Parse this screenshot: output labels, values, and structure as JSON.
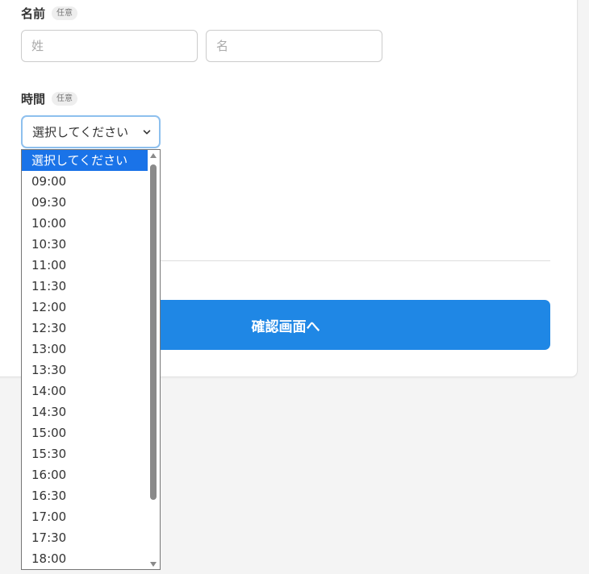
{
  "form": {
    "name": {
      "label": "名前",
      "badge": "任意",
      "last_placeholder": "姓",
      "first_placeholder": "名"
    },
    "time": {
      "label": "時間",
      "badge": "任意",
      "selected_value": "選択してください",
      "options": [
        "選択してください",
        "09:00",
        "09:30",
        "10:00",
        "10:30",
        "11:00",
        "11:30",
        "12:00",
        "12:30",
        "13:00",
        "13:30",
        "14:00",
        "14:30",
        "15:00",
        "15:30",
        "16:00",
        "16:30",
        "17:00",
        "17:30",
        "18:00"
      ],
      "highlighted_index": 0,
      "scroll_position_fraction": 0.0,
      "visible_fraction": 0.86
    },
    "submit_label": "確認画面へ"
  },
  "colors": {
    "accent": "#1f87e5",
    "option_highlight": "#1a73e8",
    "focus_ring": "#8ec0ee",
    "page_background": "#f4f4f4"
  },
  "icons": {
    "select_chevron": "chevron-down-icon",
    "scroll_up": "scroll-up-arrow-icon",
    "scroll_down": "scroll-down-arrow-icon"
  }
}
